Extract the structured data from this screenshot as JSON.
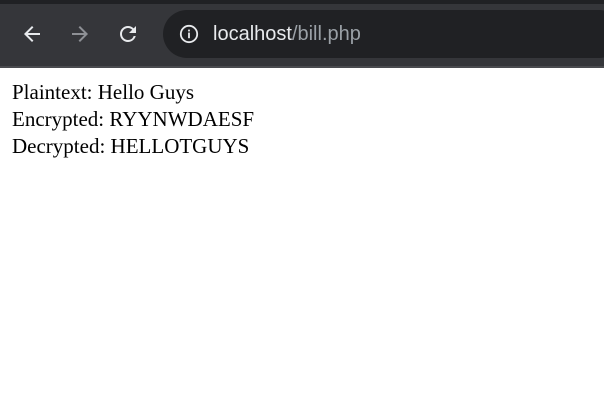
{
  "browser": {
    "back_icon": "arrow-left-icon",
    "forward_icon": "arrow-right-icon",
    "reload_icon": "reload-icon",
    "site_info_icon": "info-icon",
    "address": {
      "host": "localhost",
      "path": "/bill.php"
    },
    "colors": {
      "toolbar": "#35363a",
      "omnibox": "#202124",
      "icon_active": "#e8eaed",
      "icon_disabled": "#8e9095"
    }
  },
  "page": {
    "lines": [
      "Plaintext: Hello Guys",
      "Encrypted: RYYNWDAESF",
      "Decrypted: HELLOTGUYS"
    ]
  }
}
